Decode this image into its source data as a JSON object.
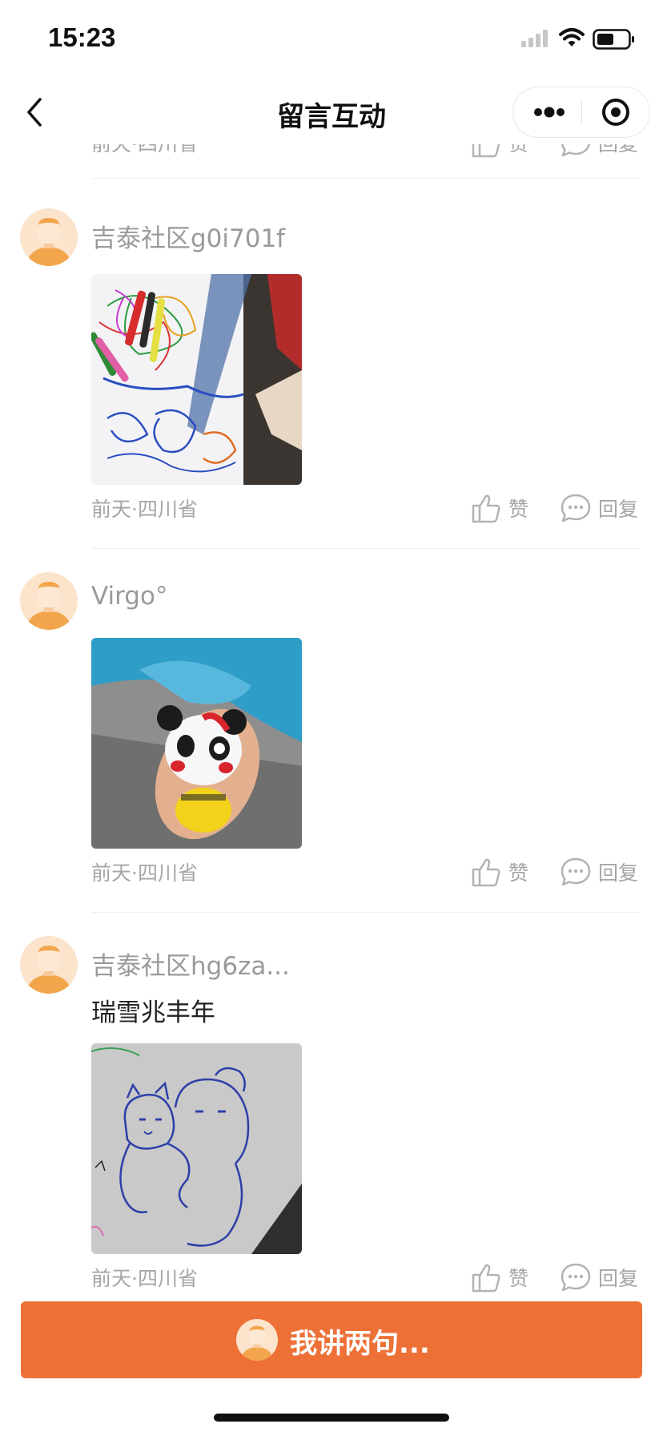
{
  "status_bar": {
    "time": "15:23"
  },
  "header": {
    "title": "留言互动"
  },
  "comments": [
    {
      "username": "",
      "meta": "前天·四川省",
      "like_label": "赞",
      "reply_label": "回复"
    },
    {
      "username": "吉泰社区g0i701f",
      "text": "",
      "photo": "children's colorful crayon drawing with markers on table",
      "meta": "前天·四川省",
      "like_label": "赞",
      "reply_label": "回复"
    },
    {
      "username": "Virgo°",
      "text": "",
      "photo": "hand holding a clay panda figure in yellow outfit",
      "meta": "前天·四川省",
      "like_label": "赞",
      "reply_label": "回复"
    },
    {
      "username": "吉泰社区hg6za...",
      "text": "瑞雪兆丰年",
      "photo": "blue-ink doodle of two hugging cartoon characters on grey paper",
      "meta": "前天·四川省",
      "like_label": "赞",
      "reply_label": "回复"
    }
  ],
  "bottom_bar": {
    "input_label": "我讲两句..."
  },
  "colors": {
    "accent": "#ed7137",
    "avatar_bg": "#fbe3cc",
    "avatar_face": "#f2a54b",
    "muted_text": "#a6a6a6"
  },
  "icons": [
    "signal-icon",
    "wifi-icon",
    "battery-icon",
    "back-chevron-icon",
    "more-dots-icon",
    "target-circle-icon",
    "thumb-up-icon",
    "chat-bubble-icon",
    "avatar-icon"
  ]
}
